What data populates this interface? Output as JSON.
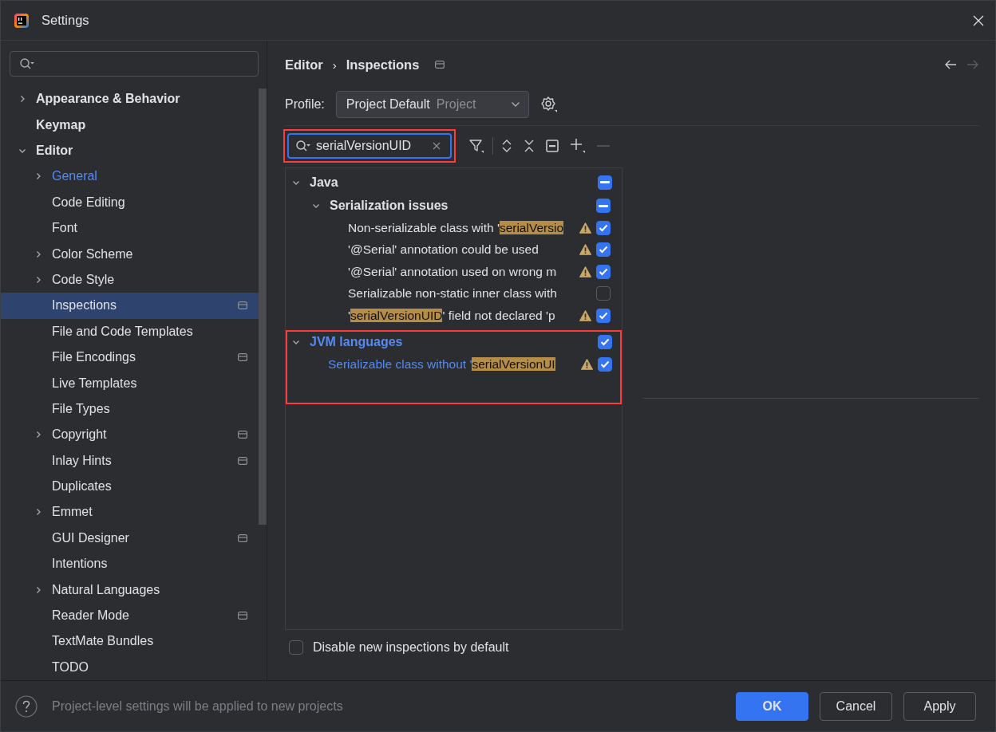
{
  "window": {
    "title": "Settings"
  },
  "sidebar": {
    "items": [
      {
        "label": "Appearance & Behavior",
        "kind": "folder",
        "expanded": false,
        "selected": false,
        "modified": false,
        "project_level": false
      },
      {
        "label": "Keymap",
        "kind": "page",
        "selected": false,
        "modified": false,
        "project_level": false
      },
      {
        "label": "Editor",
        "kind": "folder",
        "expanded": true,
        "selected": false,
        "modified": false,
        "project_level": false,
        "children": [
          {
            "label": "General",
            "kind": "folder",
            "expanded": false,
            "selected": false,
            "modified": true,
            "project_level": false
          },
          {
            "label": "Code Editing",
            "kind": "page",
            "selected": false,
            "modified": false,
            "project_level": false
          },
          {
            "label": "Font",
            "kind": "page",
            "selected": false,
            "modified": false,
            "project_level": false
          },
          {
            "label": "Color Scheme",
            "kind": "folder",
            "expanded": false,
            "selected": false,
            "modified": false,
            "project_level": false
          },
          {
            "label": "Code Style",
            "kind": "folder",
            "expanded": false,
            "selected": false,
            "modified": false,
            "project_level": false
          },
          {
            "label": "Inspections",
            "kind": "page",
            "selected": true,
            "modified": false,
            "project_level": true
          },
          {
            "label": "File and Code Templates",
            "kind": "page",
            "selected": false,
            "modified": false,
            "project_level": false
          },
          {
            "label": "File Encodings",
            "kind": "page",
            "selected": false,
            "modified": false,
            "project_level": true
          },
          {
            "label": "Live Templates",
            "kind": "page",
            "selected": false,
            "modified": false,
            "project_level": false
          },
          {
            "label": "File Types",
            "kind": "page",
            "selected": false,
            "modified": false,
            "project_level": false
          },
          {
            "label": "Copyright",
            "kind": "folder",
            "expanded": false,
            "selected": false,
            "modified": false,
            "project_level": true
          },
          {
            "label": "Inlay Hints",
            "kind": "page",
            "selected": false,
            "modified": false,
            "project_level": true
          },
          {
            "label": "Duplicates",
            "kind": "page",
            "selected": false,
            "modified": false,
            "project_level": false
          },
          {
            "label": "Emmet",
            "kind": "folder",
            "expanded": false,
            "selected": false,
            "modified": false,
            "project_level": false
          },
          {
            "label": "GUI Designer",
            "kind": "page",
            "selected": false,
            "modified": false,
            "project_level": true
          },
          {
            "label": "Intentions",
            "kind": "page",
            "selected": false,
            "modified": false,
            "project_level": false
          },
          {
            "label": "Natural Languages",
            "kind": "folder",
            "expanded": false,
            "selected": false,
            "modified": false,
            "project_level": false
          },
          {
            "label": "Reader Mode",
            "kind": "page",
            "selected": false,
            "modified": false,
            "project_level": true
          },
          {
            "label": "TextMate Bundles",
            "kind": "page",
            "selected": false,
            "modified": false,
            "project_level": false
          },
          {
            "label": "TODO",
            "kind": "page",
            "selected": false,
            "modified": false,
            "project_level": false
          }
        ]
      }
    ]
  },
  "breadcrumb": [
    "Editor",
    "Inspections"
  ],
  "breadcrumb_separator": "›",
  "project_level_page": true,
  "profile": {
    "label": "Profile:",
    "value": "Project Default",
    "scope": "Project"
  },
  "filter": {
    "value": "serialVersionUID",
    "outlined": true
  },
  "inspections": [
    {
      "label": "Java",
      "kind": "group",
      "expanded": true,
      "modified": false,
      "checked": true,
      "partial": true,
      "outlined": false,
      "children": [
        {
          "label": "Serialization issues",
          "kind": "group",
          "expanded": true,
          "modified": false,
          "checked": true,
          "partial": true,
          "outlined": false,
          "children": [
            {
              "kind": "inspection",
              "before": "Non-serializable class with '",
              "match": "serialVersio",
              "warning": true,
              "modified": false,
              "checked": true
            },
            {
              "kind": "inspection",
              "before": "'@Serial' annotation could be used",
              "warning": true,
              "modified": false,
              "checked": true
            },
            {
              "kind": "inspection",
              "before": "'@Serial' annotation used on wrong m",
              "warning": true,
              "modified": false,
              "checked": true
            },
            {
              "kind": "inspection",
              "before": "Serializable non-static inner class with",
              "warning": false,
              "modified": false,
              "checked": false
            },
            {
              "kind": "inspection",
              "before": "'",
              "match": "serialVersionUID",
              "after": "' field not declared 'p",
              "warning": true,
              "modified": false,
              "checked": true
            }
          ]
        }
      ]
    },
    {
      "label": "JVM languages",
      "kind": "group",
      "expanded": true,
      "modified": true,
      "checked": true,
      "partial": false,
      "outlined": true,
      "children": [
        {
          "kind": "inspection",
          "before": "Serializable class without '",
          "match": "serialVersionUI",
          "warning": true,
          "modified": true,
          "checked": true
        }
      ]
    }
  ],
  "disable_new": {
    "label": "Disable new inspections by default",
    "checked": false
  },
  "footer": {
    "note": "Project-level settings will be applied to new projects",
    "buttons": [
      {
        "label": "OK",
        "kind": "primary"
      },
      {
        "label": "Cancel",
        "kind": "secondary"
      },
      {
        "label": "Apply",
        "kind": "secondary"
      }
    ]
  }
}
